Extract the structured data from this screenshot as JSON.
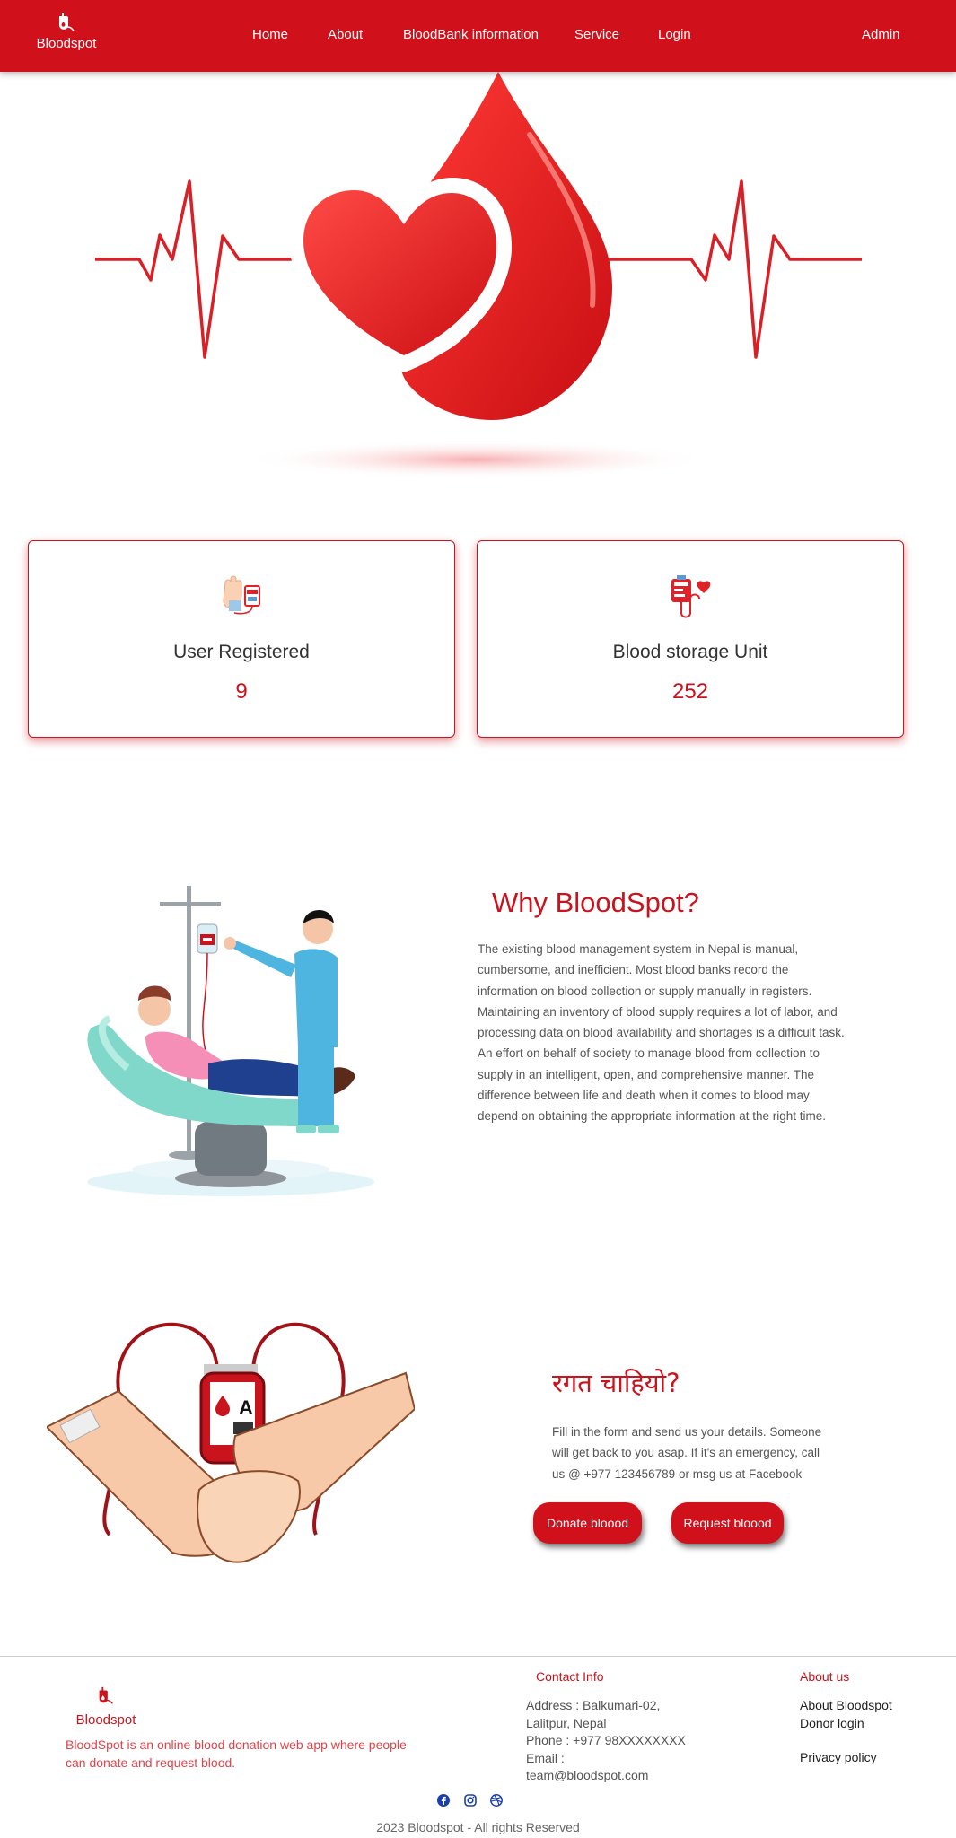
{
  "nav": {
    "brand": "Bloodspot",
    "links": [
      "Home",
      "About",
      "BloodBank information",
      "Service",
      "Login"
    ],
    "admin": "Admin"
  },
  "stats": [
    {
      "label": "User Registered",
      "value": "9",
      "icon": "hand-donation-icon"
    },
    {
      "label": "Blood storage Unit",
      "value": "252",
      "icon": "blood-bag-icon"
    }
  ],
  "why": {
    "title": "Why BloodSpot?",
    "lines": [
      "The existing blood management system in Nepal is manual,",
      "cumbersome, and inefficient. Most blood banks record the",
      "information on blood collection or supply manually in registers.",
      "Maintaining an inventory of blood supply requires a lot of labor, and",
      "processing data on blood availability and shortages is a difficult task.",
      "An effort on behalf of society to manage blood from collection to",
      "supply in an intelligent, open, and comprehensive manner. The",
      "difference between life and death when it comes to blood may",
      "depend on obtaining the appropriate information at the right time."
    ]
  },
  "need": {
    "title": "रगत चाहियो?",
    "lines": [
      "Fill in the form and send us your details. Someone",
      "will get back to you asap. If it's an emergency, call",
      "us @ +977 123456789 or msg us at Facebook"
    ],
    "donate_label": "Donate bloood",
    "request_label": "Request bloood"
  },
  "footer": {
    "brand": "Bloodspot",
    "tagline_lines": [
      "BloodSpot is an online blood donation web app where people",
      "can donate and request blood."
    ],
    "contact_title": "Contact Info",
    "contact_lines": [
      "Address : Balkumari-02,",
      "Lalitpur, Nepal",
      "Phone : +977 98XXXXXXXX",
      "Email :",
      "team@bloodspot.com"
    ],
    "about_title": "About us",
    "about_links": [
      "About Bloodspot",
      "Donor login",
      "Privacy policy"
    ],
    "social_icons": [
      "facebook-icon",
      "instagram-icon",
      "dribbble-icon"
    ],
    "copyright": "2023 Bloodspot - All rights Reserved"
  },
  "colors": {
    "brand_red": "#d0111b",
    "accent_red": "#c9131d"
  }
}
